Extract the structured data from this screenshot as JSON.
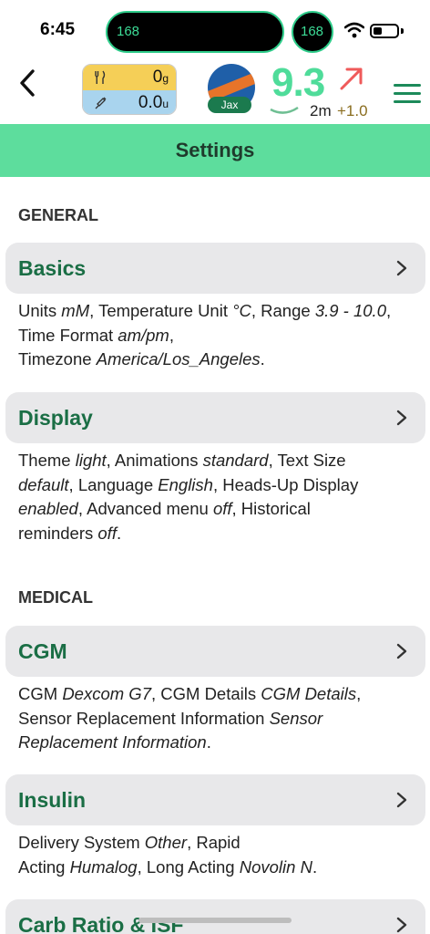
{
  "status_bar": {
    "time": "6:45",
    "island_left": "168",
    "island_right": "168"
  },
  "header": {
    "carbs_value": "0",
    "carbs_unit": "g",
    "insulin_value": "0.0",
    "insulin_unit": "u",
    "avatar_name": "Jax",
    "glucose": "9.3",
    "glucose_age": "2m",
    "glucose_delta": "+1.0",
    "trend": "up-right-arrow",
    "colors": {
      "glucose": "#4fdc9a",
      "trend": "#ef5a5a",
      "accent": "#5ddd9d",
      "label_green": "#1a6e45"
    }
  },
  "title": "Settings",
  "sections": [
    {
      "header": "GENERAL",
      "items": [
        {
          "label": "Basics",
          "parts": [
            [
              "Units ",
              "mM"
            ],
            [
              ", Temperature Unit ",
              "°C"
            ],
            [
              ", Range ",
              "3.9 - 10.0"
            ],
            [
              ", Time Format ",
              "am/pm"
            ],
            [
              ",\nTimezone ",
              "America/Los_Angeles"
            ],
            [
              ".",
              ""
            ]
          ]
        },
        {
          "label": "Display",
          "parts": [
            [
              "Theme ",
              "light"
            ],
            [
              ", Animations ",
              "standard"
            ],
            [
              ", Text Size ",
              "default"
            ],
            [
              ", Language ",
              "English"
            ],
            [
              ", Heads-Up Display ",
              "enabled"
            ],
            [
              ", Advanced menu ",
              "off"
            ],
            [
              ", Historical reminders ",
              "off"
            ],
            [
              ".",
              ""
            ]
          ]
        }
      ]
    },
    {
      "header": "MEDICAL",
      "items": [
        {
          "label": "CGM",
          "parts": [
            [
              "CGM ",
              "Dexcom G7"
            ],
            [
              ", CGM Details ",
              "CGM Details"
            ],
            [
              ", Sensor Replacement Information ",
              "Sensor Replacement Information"
            ],
            [
              ".",
              ""
            ]
          ]
        },
        {
          "label": "Insulin",
          "parts": [
            [
              "Delivery System ",
              "Other"
            ],
            [
              ", Rapid\nActing ",
              "Humalog"
            ],
            [
              ", Long Acting ",
              "Novolin N"
            ],
            [
              ".",
              ""
            ]
          ]
        },
        {
          "label": "Carb Ratio & ISF",
          "parts": []
        }
      ]
    }
  ]
}
